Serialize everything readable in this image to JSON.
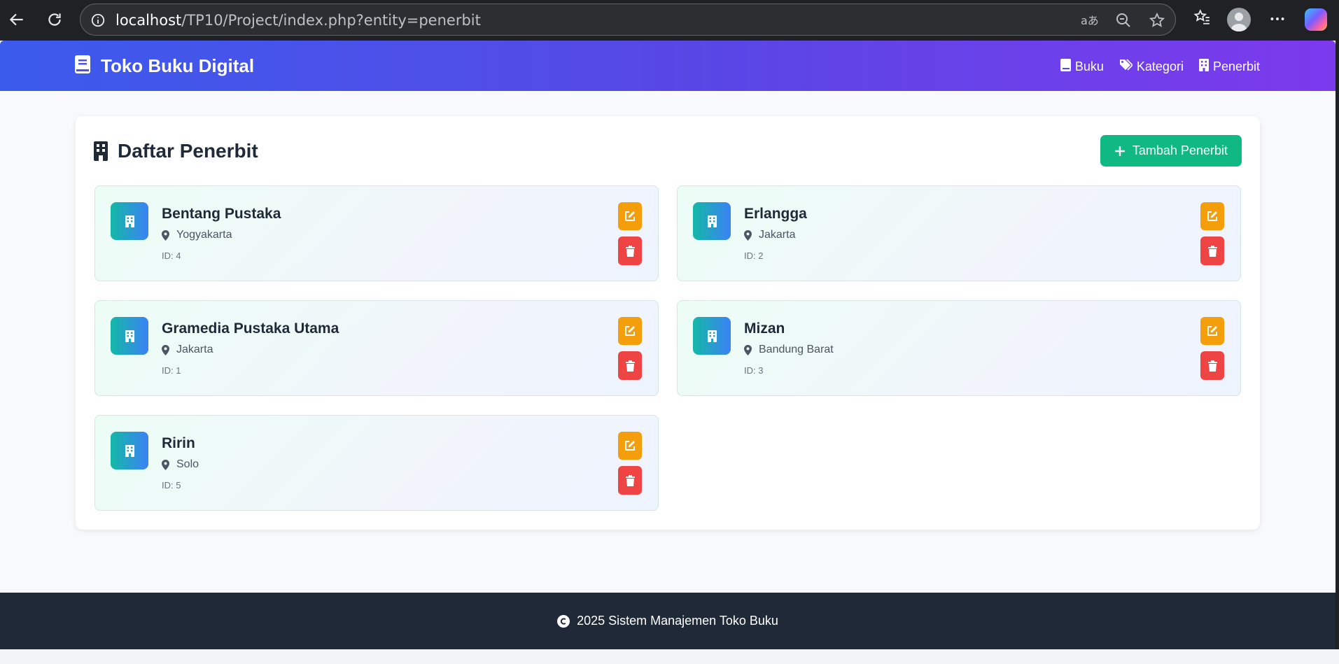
{
  "browser": {
    "url_host": "localhost",
    "url_path": "/TP10/Project/index.php?entity=penerbit"
  },
  "app": {
    "brand": "Toko Buku Digital",
    "nav": [
      {
        "label": "Buku",
        "icon": "book-icon"
      },
      {
        "label": "Kategori",
        "icon": "tags-icon"
      },
      {
        "label": "Penerbit",
        "icon": "building-icon"
      }
    ]
  },
  "page": {
    "title": "Daftar Penerbit",
    "add_button": "Tambah Penerbit"
  },
  "publishers": [
    {
      "name": "Bentang Pustaka",
      "city": "Yogyakarta",
      "id_text": "ID: 4"
    },
    {
      "name": "Erlangga",
      "city": "Jakarta",
      "id_text": "ID: 2"
    },
    {
      "name": "Gramedia Pustaka Utama",
      "city": "Jakarta",
      "id_text": "ID: 1"
    },
    {
      "name": "Mizan",
      "city": "Bandung Barat",
      "id_text": "ID: 3"
    },
    {
      "name": "Ririn",
      "city": "Solo",
      "id_text": "ID: 5"
    }
  ],
  "footer": {
    "text": "2025 Sistem Manajemen Toko Buku"
  },
  "colors": {
    "header_start": "#3b5bec",
    "header_end": "#7c3aed",
    "add_button": "#10b981",
    "edit_button": "#f59e0b",
    "delete_button": "#ef4444",
    "footer": "#1f2937"
  }
}
